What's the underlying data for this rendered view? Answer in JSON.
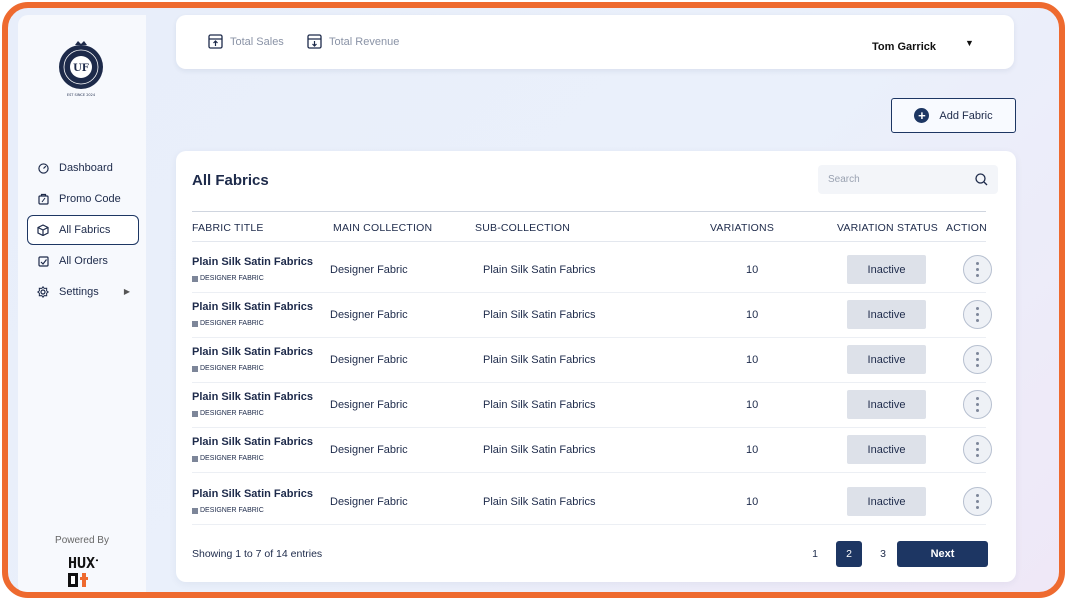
{
  "brand": {
    "logo_text": "UF",
    "logo_tagline": "EST SINCE 2024",
    "powered_by": "Powered By",
    "powered_logo": "HUXt"
  },
  "sidebar": {
    "items": [
      {
        "label": "Dashboard",
        "icon": "dashboard-icon",
        "active": false
      },
      {
        "label": "Promo Code",
        "icon": "promo-code-icon",
        "active": false
      },
      {
        "label": "All Fabrics",
        "icon": "fabric-box-icon",
        "active": true
      },
      {
        "label": "All Orders",
        "icon": "orders-icon",
        "active": false
      },
      {
        "label": "Settings",
        "icon": "gear-icon",
        "active": false,
        "has_submenu": true
      }
    ]
  },
  "header": {
    "links": [
      {
        "label": "Total Sales",
        "icon": "upload-box-icon"
      },
      {
        "label": "Total Revenue",
        "icon": "download-box-icon"
      }
    ],
    "user_name": "Tom Garrick"
  },
  "actions": {
    "add_fabric_label": "Add Fabric"
  },
  "table": {
    "title": "All Fabrics",
    "search_placeholder": "Search",
    "columns": [
      "FABRIC TITLE",
      "MAIN COLLECTION",
      "SUB-COLLECTION",
      "VARIATIONS",
      "VARIATION STATUS",
      "ACTION"
    ],
    "rows": [
      {
        "title": "Plain Silk Satin Fabrics",
        "tag": "DESIGNER FABRIC",
        "main": "Designer Fabric",
        "sub": "Plain Silk Satin Fabrics",
        "variations": "10",
        "status": "Inactive"
      },
      {
        "title": "Plain Silk Satin Fabrics",
        "tag": "DESIGNER FABRIC",
        "main": "Designer Fabric",
        "sub": "Plain Silk Satin Fabrics",
        "variations": "10",
        "status": "Inactive"
      },
      {
        "title": "Plain Silk Satin Fabrics",
        "tag": "DESIGNER FABRIC",
        "main": "Designer Fabric",
        "sub": "Plain Silk Satin Fabrics",
        "variations": "10",
        "status": "Inactive"
      },
      {
        "title": "Plain Silk Satin Fabrics",
        "tag": "DESIGNER FABRIC",
        "main": "Designer Fabric",
        "sub": "Plain Silk Satin Fabrics",
        "variations": "10",
        "status": "Inactive"
      },
      {
        "title": "Plain Silk Satin Fabrics",
        "tag": "DESIGNER FABRIC",
        "main": "Designer Fabric",
        "sub": "Plain Silk Satin Fabrics",
        "variations": "10",
        "status": "Inactive"
      },
      {
        "title": "Plain Silk Satin Fabrics",
        "tag": "DESIGNER FABRIC",
        "main": "Designer Fabric",
        "sub": "Plain Silk Satin Fabrics",
        "variations": "10",
        "status": "Inactive"
      }
    ]
  },
  "pagination": {
    "showing": "Showing 1 to 7 of 14 entries",
    "pages": [
      "1",
      "2",
      "3"
    ],
    "current": "2",
    "next_label": "Next"
  },
  "colors": {
    "accent": "#1d3663",
    "frame": "#ee6a2f",
    "status_bg": "#dde1e9"
  }
}
